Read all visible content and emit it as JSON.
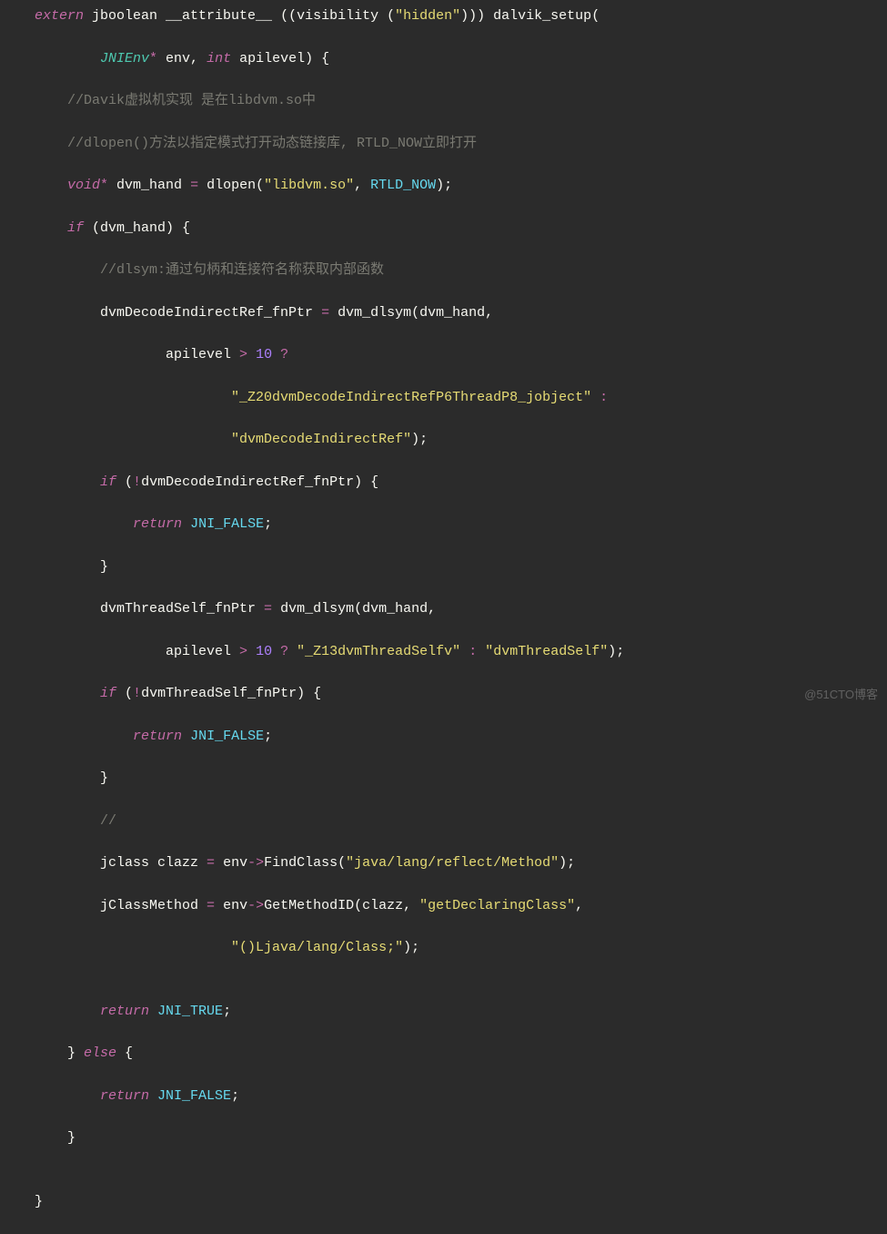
{
  "code": {
    "lines": [
      {
        "indent": 0,
        "tokens": [
          {
            "t": "extern ",
            "c": "tok-kw"
          },
          {
            "t": "jboolean __attribute__ ",
            "c": "tok-id"
          },
          {
            "t": "((",
            "c": "tok-punc"
          },
          {
            "t": "visibility ",
            "c": "tok-id"
          },
          {
            "t": "(",
            "c": "tok-punc"
          },
          {
            "t": "\"hidden\"",
            "c": "tok-str"
          },
          {
            "t": ")))",
            "c": "tok-punc"
          },
          {
            "t": " dalvik_setup",
            "c": "tok-id"
          },
          {
            "t": "(",
            "c": "tok-punc"
          }
        ]
      },
      {
        "indent": 2,
        "tokens": [
          {
            "t": "JNIEnv",
            "c": "tok-type"
          },
          {
            "t": "*",
            "c": "tok-op"
          },
          {
            "t": " env, ",
            "c": "tok-id"
          },
          {
            "t": "int",
            "c": "tok-kw"
          },
          {
            "t": " apilevel",
            "c": "tok-id"
          },
          {
            "t": ") {",
            "c": "tok-punc"
          }
        ]
      },
      {
        "indent": 1,
        "tokens": [
          {
            "t": "//Davik虚拟机实现 是在libdvm.so中",
            "c": "tok-cmt"
          }
        ]
      },
      {
        "indent": 1,
        "tokens": [
          {
            "t": "//dlopen()方法以指定模式打开动态链接库, RTLD_NOW立即打开",
            "c": "tok-cmt"
          }
        ]
      },
      {
        "indent": 1,
        "tokens": [
          {
            "t": "void",
            "c": "tok-kw"
          },
          {
            "t": "*",
            "c": "tok-op"
          },
          {
            "t": " dvm_hand ",
            "c": "tok-id"
          },
          {
            "t": "=",
            "c": "tok-op"
          },
          {
            "t": " dlopen(",
            "c": "tok-id"
          },
          {
            "t": "\"libdvm.so\"",
            "c": "tok-str"
          },
          {
            "t": ", ",
            "c": "tok-punc"
          },
          {
            "t": "RTLD_NOW",
            "c": "tok-const"
          },
          {
            "t": ");",
            "c": "tok-punc"
          }
        ]
      },
      {
        "indent": 1,
        "tokens": [
          {
            "t": "if",
            "c": "tok-kw"
          },
          {
            "t": " (dvm_hand) {",
            "c": "tok-punc"
          }
        ]
      },
      {
        "indent": 2,
        "tokens": [
          {
            "t": "//dlsym:通过句柄和连接符名称获取内部函数",
            "c": "tok-cmt"
          }
        ]
      },
      {
        "indent": 2,
        "tokens": [
          {
            "t": "dvmDecodeIndirectRef_fnPtr ",
            "c": "tok-id"
          },
          {
            "t": "=",
            "c": "tok-op"
          },
          {
            "t": " dvm_dlsym(dvm_hand,",
            "c": "tok-id"
          }
        ]
      },
      {
        "indent": 4,
        "tokens": [
          {
            "t": "apilevel ",
            "c": "tok-id"
          },
          {
            "t": ">",
            "c": "tok-op"
          },
          {
            "t": " ",
            "c": "tok-id"
          },
          {
            "t": "10",
            "c": "tok-num"
          },
          {
            "t": " ",
            "c": "tok-id"
          },
          {
            "t": "?",
            "c": "tok-op"
          }
        ]
      },
      {
        "indent": 6,
        "tokens": [
          {
            "t": "\"_Z20dvmDecodeIndirectRefP6ThreadP8_jobject\"",
            "c": "tok-str"
          },
          {
            "t": " ",
            "c": "tok-id"
          },
          {
            "t": ":",
            "c": "tok-op"
          }
        ]
      },
      {
        "indent": 6,
        "tokens": [
          {
            "t": "\"dvmDecodeIndirectRef\"",
            "c": "tok-str"
          },
          {
            "t": ");",
            "c": "tok-punc"
          }
        ]
      },
      {
        "indent": 2,
        "tokens": [
          {
            "t": "if",
            "c": "tok-kw"
          },
          {
            "t": " (",
            "c": "tok-punc"
          },
          {
            "t": "!",
            "c": "tok-op"
          },
          {
            "t": "dvmDecodeIndirectRef_fnPtr) {",
            "c": "tok-id"
          }
        ]
      },
      {
        "indent": 3,
        "tokens": [
          {
            "t": "return",
            "c": "tok-kw"
          },
          {
            "t": " ",
            "c": "tok-id"
          },
          {
            "t": "JNI_FALSE",
            "c": "tok-const"
          },
          {
            "t": ";",
            "c": "tok-punc"
          }
        ]
      },
      {
        "indent": 2,
        "tokens": [
          {
            "t": "}",
            "c": "tok-punc"
          }
        ]
      },
      {
        "indent": 2,
        "tokens": [
          {
            "t": "dvmThreadSelf_fnPtr ",
            "c": "tok-id"
          },
          {
            "t": "=",
            "c": "tok-op"
          },
          {
            "t": " dvm_dlsym(dvm_hand,",
            "c": "tok-id"
          }
        ]
      },
      {
        "indent": 4,
        "tokens": [
          {
            "t": "apilevel ",
            "c": "tok-id"
          },
          {
            "t": ">",
            "c": "tok-op"
          },
          {
            "t": " ",
            "c": "tok-id"
          },
          {
            "t": "10",
            "c": "tok-num"
          },
          {
            "t": " ",
            "c": "tok-id"
          },
          {
            "t": "?",
            "c": "tok-op"
          },
          {
            "t": " ",
            "c": "tok-id"
          },
          {
            "t": "\"_Z13dvmThreadSelfv\"",
            "c": "tok-str"
          },
          {
            "t": " ",
            "c": "tok-id"
          },
          {
            "t": ":",
            "c": "tok-op"
          },
          {
            "t": " ",
            "c": "tok-id"
          },
          {
            "t": "\"dvmThreadSelf\"",
            "c": "tok-str"
          },
          {
            "t": ");",
            "c": "tok-punc"
          }
        ]
      },
      {
        "indent": 2,
        "tokens": [
          {
            "t": "if",
            "c": "tok-kw"
          },
          {
            "t": " (",
            "c": "tok-punc"
          },
          {
            "t": "!",
            "c": "tok-op"
          },
          {
            "t": "dvmThreadSelf_fnPtr) {",
            "c": "tok-id"
          }
        ]
      },
      {
        "indent": 3,
        "tokens": [
          {
            "t": "return",
            "c": "tok-kw"
          },
          {
            "t": " ",
            "c": "tok-id"
          },
          {
            "t": "JNI_FALSE",
            "c": "tok-const"
          },
          {
            "t": ";",
            "c": "tok-punc"
          }
        ]
      },
      {
        "indent": 2,
        "tokens": [
          {
            "t": "}",
            "c": "tok-punc"
          }
        ]
      },
      {
        "indent": 2,
        "tokens": [
          {
            "t": "//",
            "c": "tok-cmt"
          }
        ]
      },
      {
        "indent": 2,
        "tokens": [
          {
            "t": "jclass clazz ",
            "c": "tok-id"
          },
          {
            "t": "=",
            "c": "tok-op"
          },
          {
            "t": " env",
            "c": "tok-id"
          },
          {
            "t": "->",
            "c": "tok-op"
          },
          {
            "t": "FindClass(",
            "c": "tok-id"
          },
          {
            "t": "\"java/lang/reflect/Method\"",
            "c": "tok-str"
          },
          {
            "t": ");",
            "c": "tok-punc"
          }
        ]
      },
      {
        "indent": 2,
        "tokens": [
          {
            "t": "jClassMethod ",
            "c": "tok-id"
          },
          {
            "t": "=",
            "c": "tok-op"
          },
          {
            "t": " env",
            "c": "tok-id"
          },
          {
            "t": "->",
            "c": "tok-op"
          },
          {
            "t": "GetMethodID(clazz, ",
            "c": "tok-id"
          },
          {
            "t": "\"getDeclaringClass\"",
            "c": "tok-str"
          },
          {
            "t": ",",
            "c": "tok-punc"
          }
        ]
      },
      {
        "indent": 6,
        "tokens": [
          {
            "t": "\"()Ljava/lang/Class;\"",
            "c": "tok-str"
          },
          {
            "t": ");",
            "c": "tok-punc"
          }
        ]
      },
      {
        "indent": 0,
        "tokens": [
          {
            "t": "",
            "c": "tok-id"
          }
        ]
      },
      {
        "indent": 2,
        "tokens": [
          {
            "t": "return",
            "c": "tok-kw"
          },
          {
            "t": " ",
            "c": "tok-id"
          },
          {
            "t": "JNI_TRUE",
            "c": "tok-const"
          },
          {
            "t": ";",
            "c": "tok-punc"
          }
        ]
      },
      {
        "indent": 1,
        "tokens": [
          {
            "t": "} ",
            "c": "tok-punc"
          },
          {
            "t": "else",
            "c": "tok-kw"
          },
          {
            "t": " {",
            "c": "tok-punc"
          }
        ]
      },
      {
        "indent": 2,
        "tokens": [
          {
            "t": "return",
            "c": "tok-kw"
          },
          {
            "t": " ",
            "c": "tok-id"
          },
          {
            "t": "JNI_FALSE",
            "c": "tok-const"
          },
          {
            "t": ";",
            "c": "tok-punc"
          }
        ]
      },
      {
        "indent": 1,
        "tokens": [
          {
            "t": "}",
            "c": "tok-punc"
          }
        ]
      },
      {
        "indent": 0,
        "tokens": [
          {
            "t": "",
            "c": "tok-id"
          }
        ]
      },
      {
        "indent": 0,
        "tokens": [
          {
            "t": "}",
            "c": "tok-punc"
          }
        ]
      }
    ]
  },
  "watermark": "@51CTO博客",
  "indent_unit": "    "
}
